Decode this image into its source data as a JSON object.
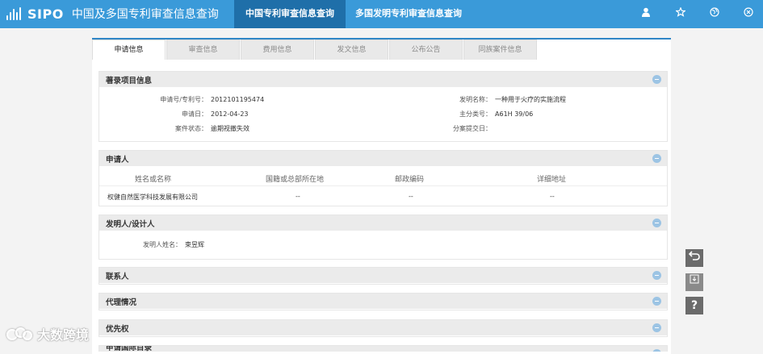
{
  "header": {
    "logo_text": "SIPO",
    "app_title": "中国及多国专利审查信息查询",
    "nav": [
      {
        "label": "中国专利审查信息查询"
      },
      {
        "label": "多国发明专利审查信息查询"
      }
    ],
    "icons": [
      "user-icon",
      "star-icon",
      "globe-icon",
      "close-icon"
    ]
  },
  "tabs": [
    "申请信息",
    "审查信息",
    "费用信息",
    "发文信息",
    "公布公告",
    "同族案件信息"
  ],
  "biblio": {
    "title": "著录项目信息",
    "left": [
      {
        "k": "申请号/专利号：",
        "v": "2012101195474"
      },
      {
        "k": "申请日：",
        "v": "2012-04-23"
      },
      {
        "k": "案件状态：",
        "v": "逾期视撤失效"
      }
    ],
    "right": [
      {
        "k": "发明名称：",
        "v": "一种用于火疗的实施流程"
      },
      {
        "k": "主分类号：",
        "v": "A61H 39/06"
      },
      {
        "k": "分案提交日：",
        "v": ""
      }
    ]
  },
  "applicant": {
    "title": "申请人",
    "columns": [
      "姓名或名称",
      "国籍或总部所在地",
      "邮政编码",
      "详细地址"
    ],
    "row": [
      "权健自然医学科技发展有限公司",
      "--",
      "--",
      "--"
    ]
  },
  "inventor": {
    "title": "发明人/设计人",
    "label": "发明人姓名：",
    "value": "束昱辉"
  },
  "sections": [
    "联系人",
    "代理情况",
    "优先权",
    "申请国际目录"
  ],
  "watermark": "大数跨境"
}
